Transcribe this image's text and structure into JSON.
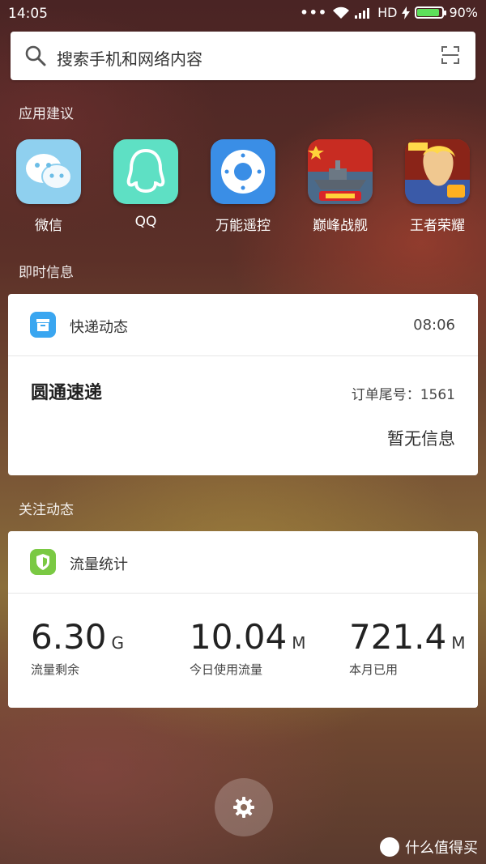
{
  "status_bar": {
    "time": "14:05",
    "dots": "•••",
    "network": "HD",
    "battery_percent": "90%",
    "battery_level": 0.9,
    "battery_color": "#5ee05a"
  },
  "search": {
    "placeholder": "搜索手机和网络内容",
    "icon": "search-icon",
    "scan_icon": "scan-icon"
  },
  "sections": {
    "app_suggestions": "应用建议",
    "instant_info": "即时信息",
    "followed": "关注动态"
  },
  "apps": [
    {
      "label": "微信",
      "icon": "wechat-icon",
      "color": "#8fd0ef"
    },
    {
      "label": "QQ",
      "icon": "qq-icon",
      "color": "#5ee0c4"
    },
    {
      "label": "万能遥控",
      "icon": "remote-control-icon",
      "color": "#3a8ee6"
    },
    {
      "label": "巅峰战舰",
      "icon": "warship-game-icon",
      "color": "#c82c22"
    },
    {
      "label": "王者荣耀",
      "icon": "honor-of-kings-icon",
      "color": "#b8422a"
    }
  ],
  "express_card": {
    "title": "快递动态",
    "time": "08:06",
    "courier": "圆通速递",
    "order_tail": "订单尾号：1561",
    "status": "暂无信息",
    "icon_color": "#3aa6f0"
  },
  "traffic_card": {
    "title": "流量统计",
    "icon_color": "#7ac943",
    "stats": [
      {
        "value": "6.30",
        "unit": "G",
        "caption": "流量剩余"
      },
      {
        "value": "10.04",
        "unit": "M",
        "caption": "今日使用流量"
      },
      {
        "value": "721.4",
        "unit": "M",
        "caption": "本月已用"
      }
    ]
  },
  "watermark": {
    "badge": "值",
    "text": "什么值得买"
  }
}
